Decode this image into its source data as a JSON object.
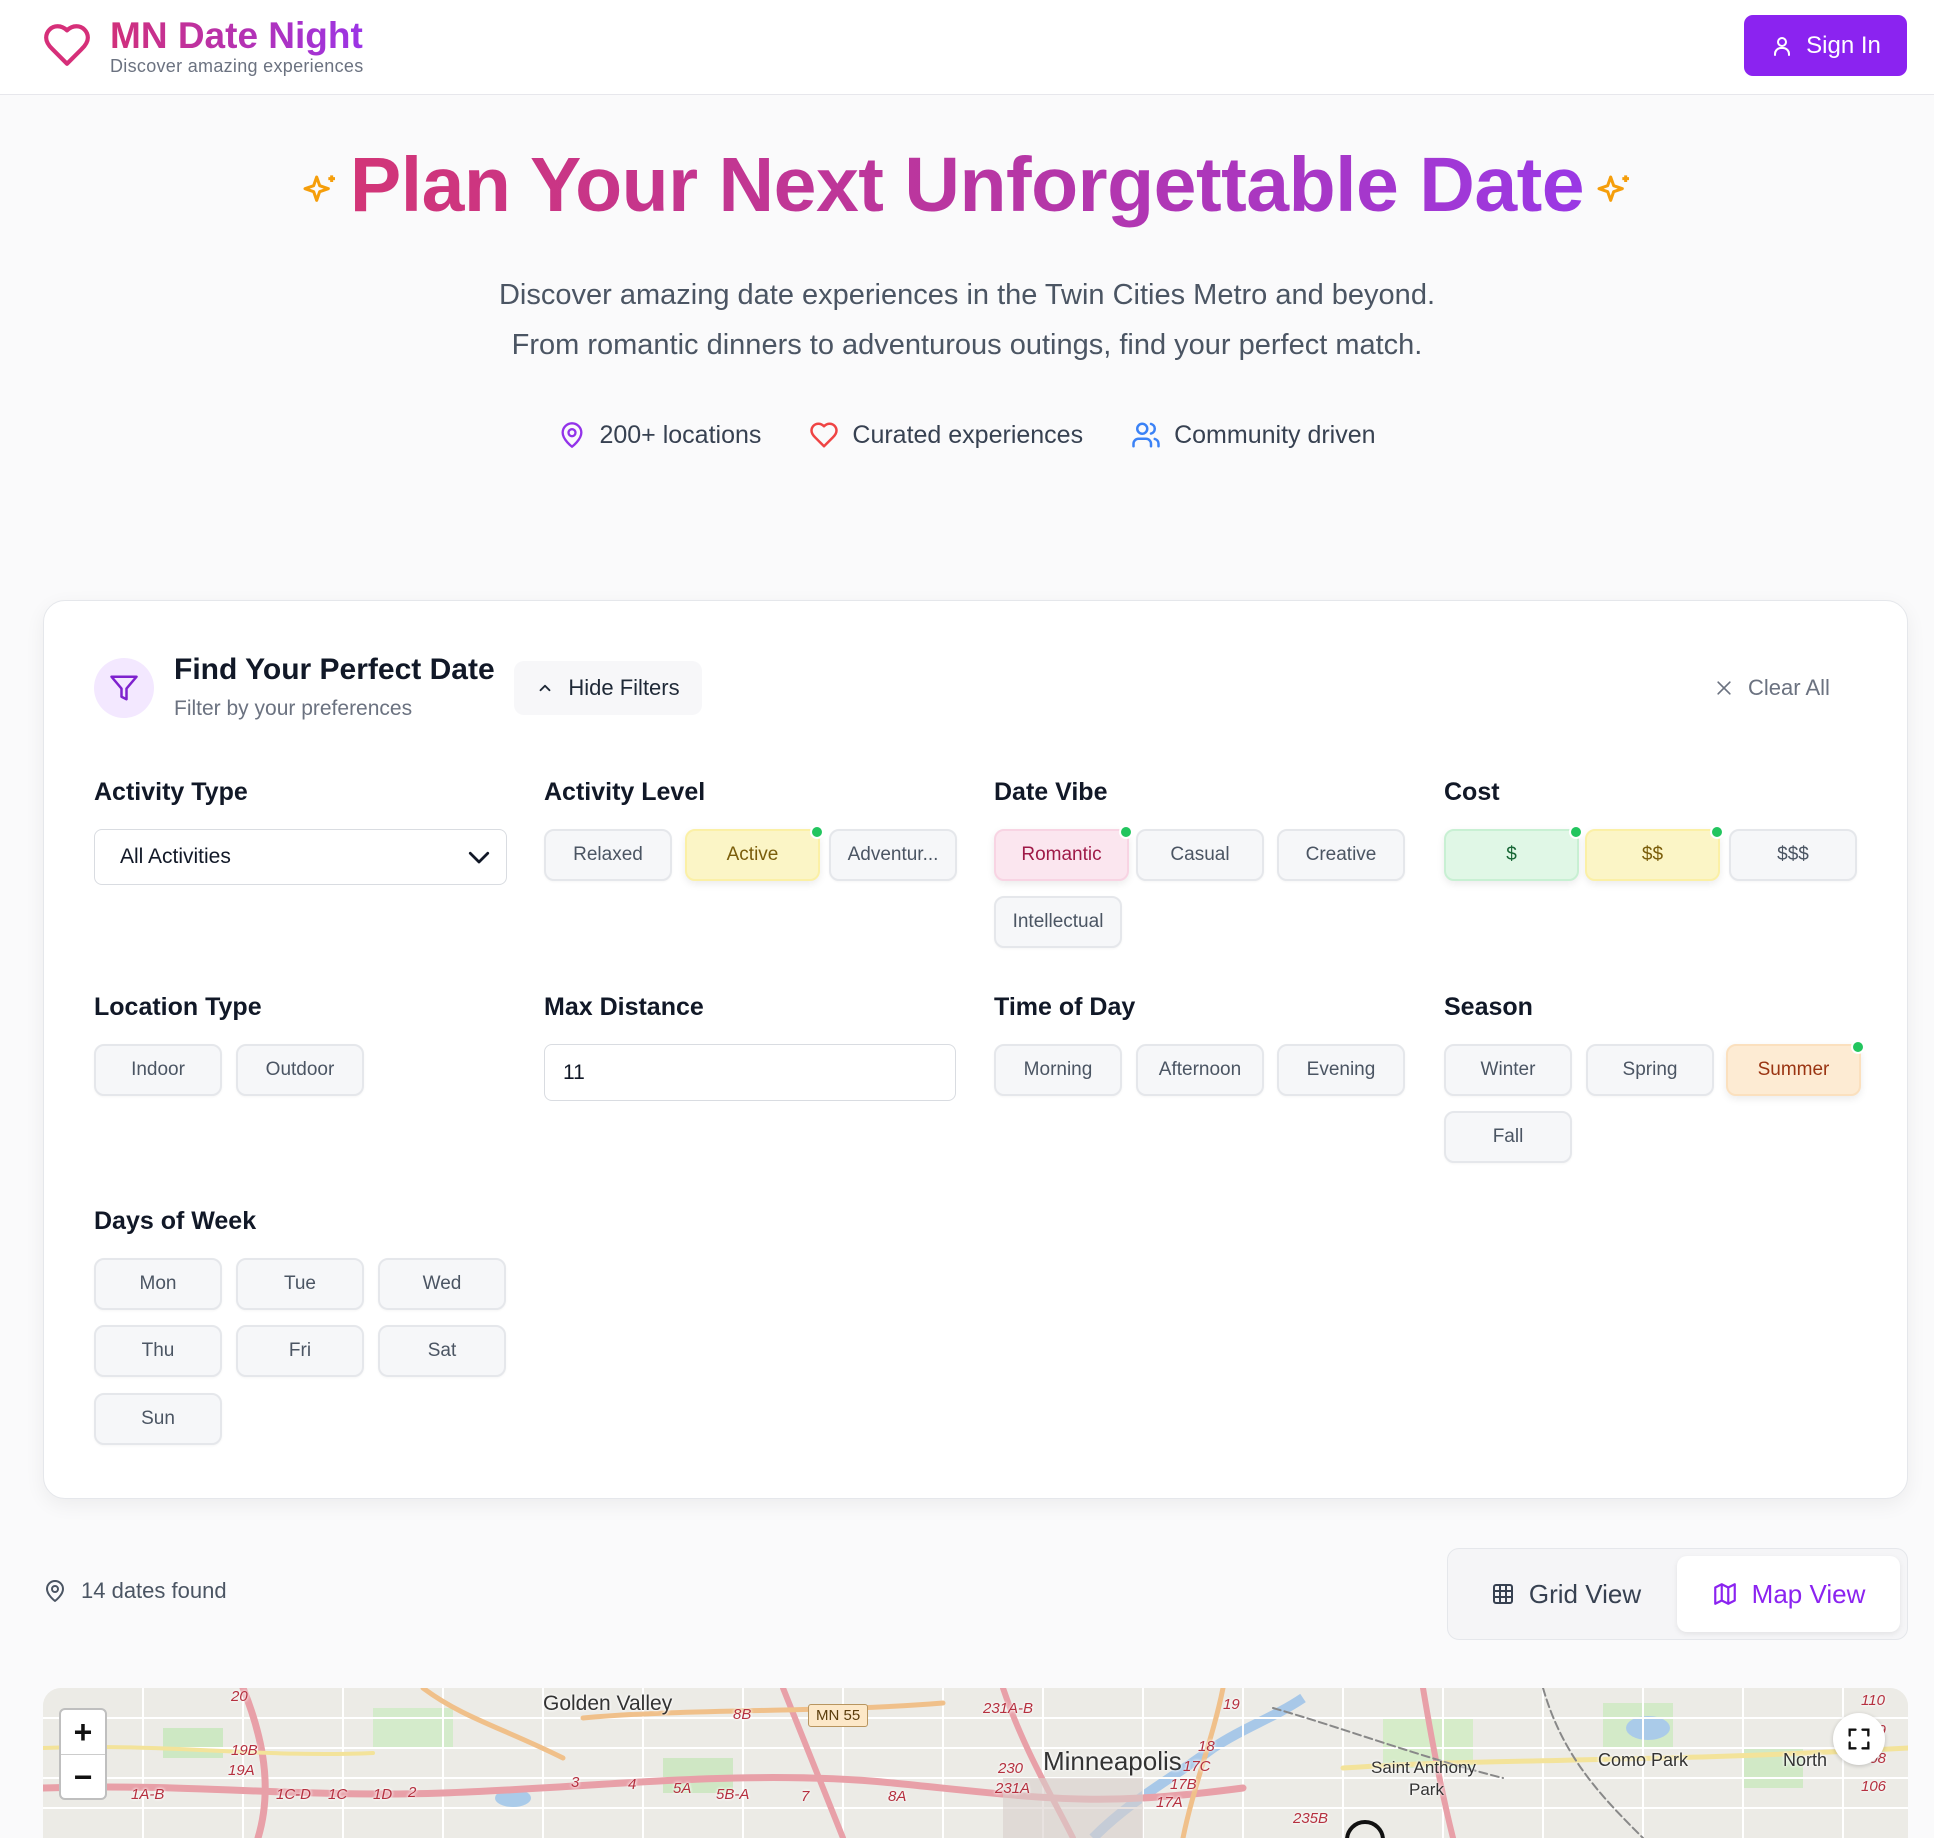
{
  "header": {
    "brand_title": "MN Date Night",
    "brand_subtitle": "Discover amazing experiences",
    "sign_in_label": "Sign In",
    "accent_color": "#8b23f0"
  },
  "hero": {
    "title": "Plan Your Next Unforgettable Date",
    "description_line1": "Discover amazing date experiences in the Twin Cities Metro and beyond.",
    "description_line2": "From romantic dinners to adventurous outings, find your perfect match.",
    "stats": [
      {
        "icon": "map-pin-icon",
        "label": "200+ locations"
      },
      {
        "icon": "heart-icon",
        "label": "Curated experiences"
      },
      {
        "icon": "users-icon",
        "label": "Community driven"
      }
    ]
  },
  "filters": {
    "title": "Find Your Perfect Date",
    "subtitle": "Filter by your preferences",
    "hide_label": "Hide Filters",
    "clear_label": "Clear All",
    "activity_type": {
      "label": "Activity Type",
      "selected": "All Activities"
    },
    "activity_level": {
      "label": "Activity Level",
      "options": [
        "Relaxed",
        "Active",
        "Adventur..."
      ],
      "selected": [
        "Active"
      ]
    },
    "date_vibe": {
      "label": "Date Vibe",
      "options": [
        "Romantic",
        "Casual",
        "Creative",
        "Intellectual"
      ],
      "selected": [
        "Romantic"
      ]
    },
    "cost": {
      "label": "Cost",
      "options": [
        "$",
        "$$",
        "$$$"
      ],
      "selected": [
        "$",
        "$$"
      ]
    },
    "location_type": {
      "label": "Location Type",
      "options": [
        "Indoor",
        "Outdoor"
      ],
      "selected": []
    },
    "max_distance": {
      "label": "Max Distance",
      "value": "11"
    },
    "time_of_day": {
      "label": "Time of Day",
      "options": [
        "Morning",
        "Afternoon",
        "Evening"
      ],
      "selected": []
    },
    "season": {
      "label": "Season",
      "options": [
        "Winter",
        "Spring",
        "Summer",
        "Fall"
      ],
      "selected": [
        "Summer"
      ]
    },
    "days_of_week": {
      "label": "Days of Week",
      "options": [
        "Mon",
        "Tue",
        "Wed",
        "Thu",
        "Fri",
        "Sat",
        "Sun"
      ],
      "selected": []
    }
  },
  "results": {
    "count_text": "14 dates found",
    "grid_view_label": "Grid View",
    "map_view_label": "Map View",
    "active_view": "Map View"
  },
  "map": {
    "labels": [
      "Golden Valley",
      "Minneapolis",
      "Saint Anthony",
      "Park",
      "Como Park",
      "North"
    ],
    "shield": "MN 55",
    "road_labels": [
      "8B",
      "231A-B",
      "19",
      "18",
      "17C",
      "17B",
      "17A",
      "230",
      "231A",
      "20",
      "19B",
      "19A",
      "1A-B",
      "1C-D",
      "1C",
      "1D",
      "2",
      "3",
      "4",
      "5A",
      "5B-A",
      "7",
      "8A",
      "235B",
      "110",
      "109",
      "108",
      "106"
    ],
    "zoom_in": "+",
    "zoom_out": "−"
  }
}
